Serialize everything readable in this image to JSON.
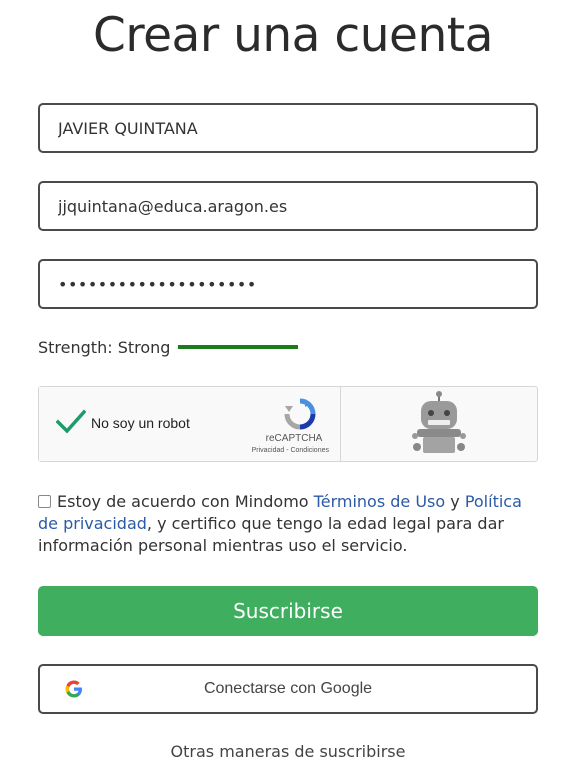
{
  "page": {
    "title": "Crear una cuenta"
  },
  "form": {
    "name_value": "JAVIER QUINTANA",
    "email_value": "jjquintana@educa.aragon.es",
    "password_value": "••••••••••••••••••••",
    "strength_label": "Strength: Strong",
    "strength_color": "#1a7c1a"
  },
  "captcha": {
    "label": "No soy un robot",
    "brand": "reCAPTCHA",
    "links": "Privacidad - Condiciones",
    "check_color": "#1e9b6a",
    "icons": [
      "checkmark-icon",
      "recaptcha-logo-icon",
      "robot-icon"
    ]
  },
  "terms": {
    "prefix": "Estoy de acuerdo con Mindomo ",
    "terms_link": "Términos de Uso",
    "conj": " y ",
    "privacy_link": "Política de privacidad",
    "suffix": ", y certifico que tengo la edad legal para dar información personal mientras uso el servicio."
  },
  "buttons": {
    "subscribe": "Suscribirse",
    "subscribe_color": "#3faf5f",
    "google": "Conectarse con Google",
    "other": "Otras maneras de suscribirse"
  }
}
